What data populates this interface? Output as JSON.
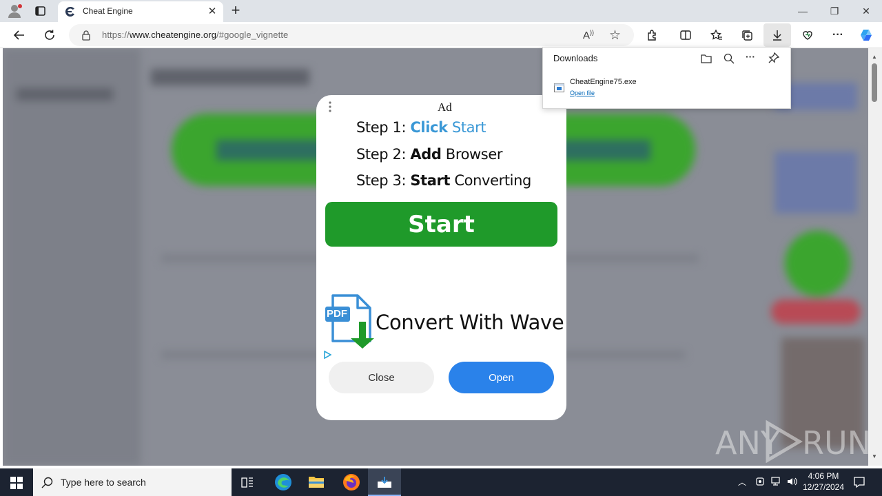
{
  "browser": {
    "tab_title": "Cheat Engine",
    "url_prefix": "https://",
    "url_host": "www.cheatengine.org",
    "url_rest": "/#google_vignette"
  },
  "downloads": {
    "title": "Downloads",
    "file_name": "CheatEngine75.exe",
    "open_file_label": "Open file"
  },
  "ad": {
    "label": "Ad",
    "step1_prefix": "Step 1: ",
    "step1_bold": "Click",
    "step1_rest": " Start",
    "step2_prefix": "Step 2: ",
    "step2_bold": "Add",
    "step2_rest": " Browser",
    "step3_prefix": "Step 3: ",
    "step3_bold": "Start",
    "step3_rest": " Converting",
    "start_button": "Start",
    "pdf_badge": "PDF",
    "convert_text": "Convert With Wave",
    "close_button": "Close",
    "open_button": "Open"
  },
  "taskbar": {
    "search_placeholder": "Type here to search",
    "time": "4:06 PM",
    "date": "12/27/2024"
  },
  "watermark": {
    "text_left": "ANY",
    "text_right": "RUN"
  },
  "colors": {
    "start_green": "#1f9a2a",
    "open_blue": "#2a82ea",
    "link_blue": "#0067b8"
  }
}
